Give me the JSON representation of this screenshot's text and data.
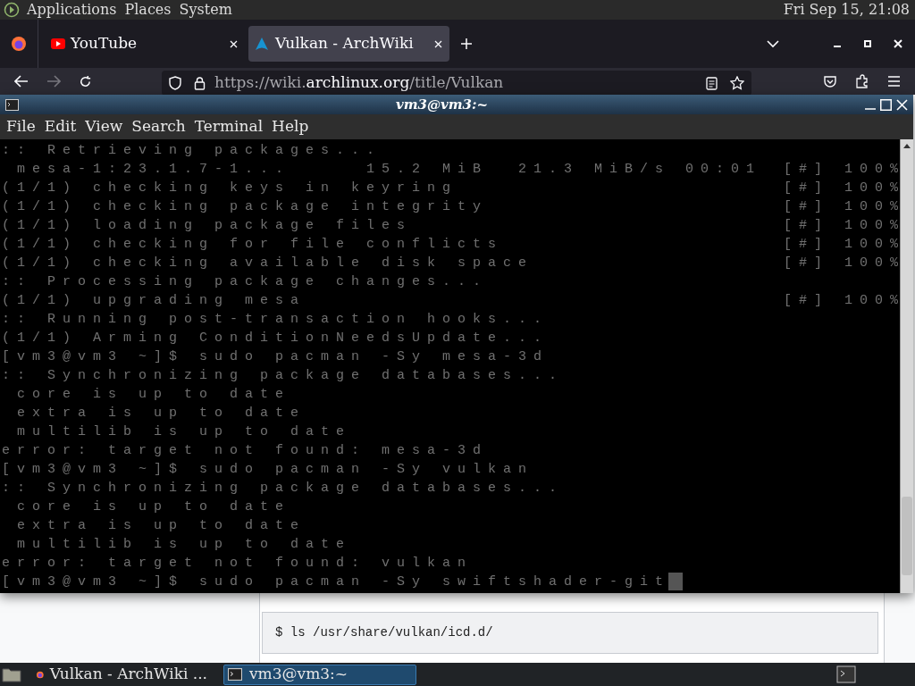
{
  "top_panel": {
    "menus": [
      "Applications",
      "Places",
      "System"
    ],
    "clock": "Fri Sep 15, 21:08"
  },
  "browser": {
    "tabs": [
      {
        "title": "YouTube",
        "selected": false
      },
      {
        "title": "Vulkan - ArchWiki",
        "selected": true
      }
    ],
    "url": {
      "prefix": "https://wiki.",
      "domain": "archlinux.org",
      "path": "/title/Vulkan"
    },
    "code_block": "$ ls /usr/share/vulkan/icd.d/"
  },
  "terminal": {
    "title": "vm3@vm3:~",
    "menu": [
      "File",
      "Edit",
      "View",
      "Search",
      "Terminal",
      "Help"
    ],
    "lines": [
      {
        "text": ":: Retrieving packages..."
      },
      {
        "text": " mesa-1:23.1.7-1...     15.2 MiB  21.3 MiB/s 00:01",
        "progress": "[#] 100%"
      },
      {
        "text": "(1/1) checking keys in keyring",
        "progress": "[#] 100%"
      },
      {
        "text": "(1/1) checking package integrity",
        "progress": "[#] 100%"
      },
      {
        "text": "(1/1) loading package files",
        "progress": "[#] 100%"
      },
      {
        "text": "(1/1) checking for file conflicts",
        "progress": "[#] 100%"
      },
      {
        "text": "(1/1) checking available disk space",
        "progress": "[#] 100%"
      },
      {
        "text": ":: Processing package changes..."
      },
      {
        "text": "(1/1) upgrading mesa",
        "progress": "[#] 100%"
      },
      {
        "text": ":: Running post-transaction hooks..."
      },
      {
        "text": "(1/1) Arming ConditionNeedsUpdate..."
      },
      {
        "text": "[vm3@vm3 ~]$ sudo pacman -Sy mesa-3d"
      },
      {
        "text": ":: Synchronizing package databases..."
      },
      {
        "text": " core is up to date"
      },
      {
        "text": " extra is up to date"
      },
      {
        "text": " multilib is up to date"
      },
      {
        "text": "error: target not found: mesa-3d"
      },
      {
        "text": "[vm3@vm3 ~]$ sudo pacman -Sy vulkan"
      },
      {
        "text": ":: Synchronizing package databases..."
      },
      {
        "text": " core is up to date"
      },
      {
        "text": " extra is up to date"
      },
      {
        "text": " multilib is up to date"
      },
      {
        "text": "error: target not found: vulkan"
      },
      {
        "text": "[vm3@vm3 ~]$ sudo pacman -Sy swiftshader-git",
        "cursor": true
      }
    ]
  },
  "taskbar": {
    "tasks": [
      {
        "title": "Vulkan - ArchWiki ...",
        "selected": false
      },
      {
        "title": "vm3@vm3:~",
        "selected": true
      }
    ]
  }
}
